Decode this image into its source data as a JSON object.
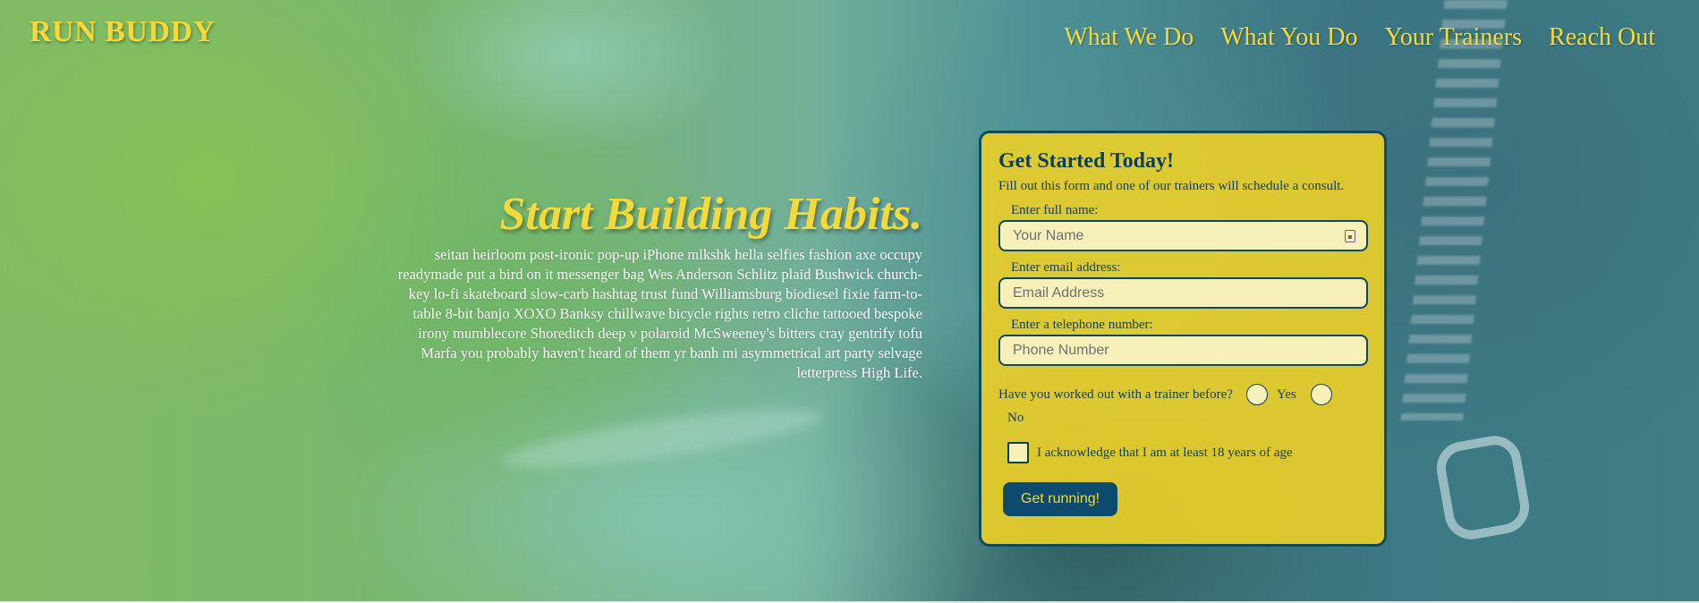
{
  "header": {
    "brand": "RUN BUDDY",
    "nav": [
      "What We Do",
      "What You Do",
      "Your Trainers",
      "Reach Out"
    ]
  },
  "hero": {
    "title": "Start Building Habits.",
    "body": "seitan heirloom post-ironic pop-up iPhone mlkshk hella selfies fashion axe occupy readymade put a bird on it messenger bag Wes Anderson Schlitz plaid Bushwick church-key lo-fi skateboard slow-carb hashtag trust fund Williamsburg biodiesel fixie farm-to-table 8-bit banjo XOXO Banksy chillwave bicycle rights retro cliche tattooed bespoke irony mumblecore Shoreditch deep v polaroid McSweeney's bitters cray gentrify tofu Marfa you probably haven't heard of them yr banh mi asymmetrical art party selvage letterpress High Life."
  },
  "form": {
    "title": "Get Started Today!",
    "subtitle": "Fill out this form and one of our trainers will schedule a consult.",
    "name_label": "Enter full name:",
    "name_placeholder": "Your Name",
    "email_label": "Enter email address:",
    "email_placeholder": "Email Address",
    "phone_label": "Enter a telephone number:",
    "phone_placeholder": "Phone Number",
    "trainer_question": "Have you worked out with a trainer before?",
    "yes_label": "Yes",
    "no_label": "No",
    "age_ack": "I acknowledge that I am at least 18 years of age",
    "submit_label": "Get running!"
  },
  "colors": {
    "accent_yellow": "#f3d93a",
    "card_bg": "#e8ce2a",
    "dark_teal": "#0c4a5e",
    "button_bg": "#0c4a6e"
  }
}
